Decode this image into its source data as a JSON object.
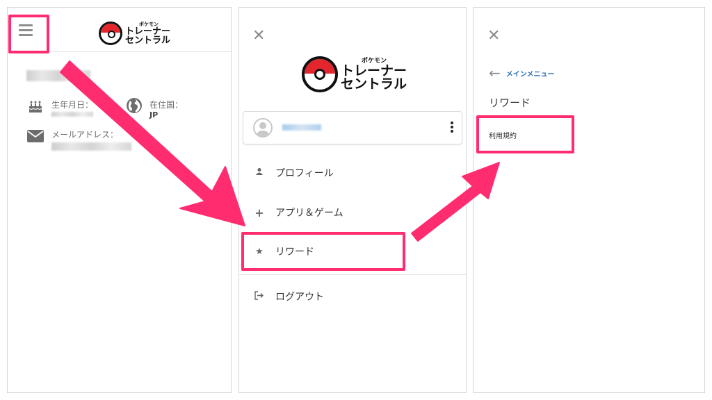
{
  "logo": {
    "small_text": "ポケモン",
    "line1": "トレーナー",
    "line2": "セントラル",
    "colors": {
      "red": "#e3262d",
      "black": "#111111"
    }
  },
  "panel1": {
    "menu_icon": "hamburger-icon",
    "birthday_label": "生年月日：",
    "country_label": "在住国：",
    "country_value": "JP",
    "email_label": "メールアドレス：",
    "icons": [
      "cake-icon",
      "globe-icon",
      "envelope-icon"
    ]
  },
  "panel2": {
    "close_icon": "close-icon",
    "menu": [
      {
        "label": "プロフィール",
        "icon": "person-icon"
      },
      {
        "label": "アプリ＆ゲーム",
        "icon": "plus-icon"
      },
      {
        "label": "リワード",
        "icon": "star-icon"
      },
      {
        "label": "ログアウト",
        "icon": "logout-icon"
      }
    ]
  },
  "panel3": {
    "back_label": "メインメニュー",
    "section_title": "リワード",
    "sub_items": [
      "利用規約"
    ]
  },
  "annotation_color": "#ff2d70"
}
